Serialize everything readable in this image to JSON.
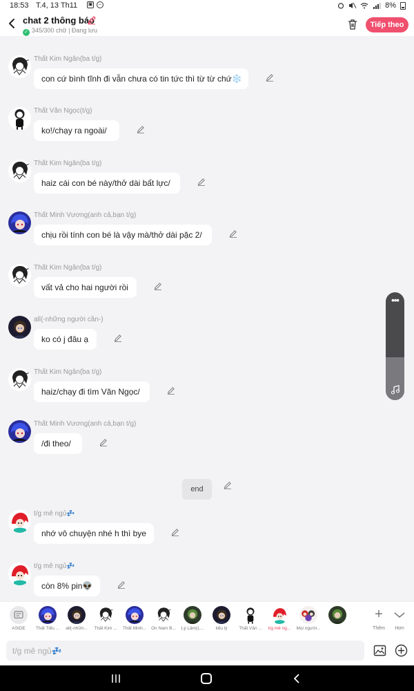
{
  "status_bar": {
    "time": "18:53",
    "date": "T.4, 13 Th11",
    "battery": "8%"
  },
  "header": {
    "title": "chat 2 thông báo",
    "subtitle": "345/300 chữ | Đang lưu",
    "next_label": "Tiếp theo"
  },
  "messages": [
    {
      "name": "Thất Kim Ngân(ba t/g)",
      "text": "con cứ bình tĩnh đi vẫn chưa có tin tức thì từ từ chứ❄️",
      "avatar": "girl-bw"
    },
    {
      "name": "Thất Văn Ngọc(t/g)",
      "text": "ko!/chạy ra ngoài/",
      "avatar": "chibi-black"
    },
    {
      "name": "Thất Kim Ngân(ba t/g)",
      "text": "haiz cái con bé này/thở dài bất lực/",
      "avatar": "girl-bw"
    },
    {
      "name": "Thất Minh Vương(anh cả,bạn t/g)",
      "text": "chịu rồi tính con bé là vậy mà/thở dài pặc 2/",
      "avatar": "boy-blue"
    },
    {
      "name": "Thất Kim Ngân(ba t/g)",
      "text": "vất vả cho hai người rồi",
      "avatar": "girl-bw"
    },
    {
      "name": "all(-những người cần-)",
      "text": "ko có j đâu ạ",
      "avatar": "all-dark"
    },
    {
      "name": "Thất Kim Ngân(ba t/g)",
      "text": "haiz/chạy đi tìm Văn Ngọc/",
      "avatar": "girl-bw"
    },
    {
      "name": "Thất Minh Vương(anh cả,bạn t/g)",
      "text": "/đi theo/",
      "avatar": "boy-blue"
    },
    {
      "name": "t/g mê ngủ💤",
      "text": "nhớ vô chuyện nhé h thì bye",
      "avatar": "girl-red"
    },
    {
      "name": "t/g mê ngủ💤",
      "text": "còn 8% pin👽",
      "avatar": "girl-red"
    }
  ],
  "end_label": "end",
  "character_bar": {
    "characters": [
      {
        "label": "ASIDE",
        "avatar": "aside"
      },
      {
        "label": "Thất Tiểu ...",
        "avatar": "boy-blue"
      },
      {
        "label": "all(-nhữn...",
        "avatar": "all-dark"
      },
      {
        "label": "Thất Kim ...",
        "avatar": "girl-bw"
      },
      {
        "label": "Thất Minh...",
        "avatar": "boy-blue"
      },
      {
        "label": "Ôn Nam B...",
        "avatar": "girl-bw"
      },
      {
        "label": "Lý Lâm(L...",
        "avatar": "green-dark"
      },
      {
        "label": "tiểu lý",
        "avatar": "all-dark"
      },
      {
        "label": "Thất Văn ...",
        "avatar": "chibi-black"
      },
      {
        "label": "t/g mê ng...",
        "avatar": "girl-red",
        "active": true
      },
      {
        "label": "Mọi người...",
        "avatar": "mixed-red"
      },
      {
        "label": "",
        "avatar": "green-dark"
      }
    ],
    "add_label": "Thêm",
    "more_label": "Hơn"
  },
  "input": {
    "placeholder": "t/g mê ngủ💤"
  },
  "colors": {
    "accent": "#f0506e",
    "background": "#f3f3f5",
    "bubble": "#ffffff"
  }
}
